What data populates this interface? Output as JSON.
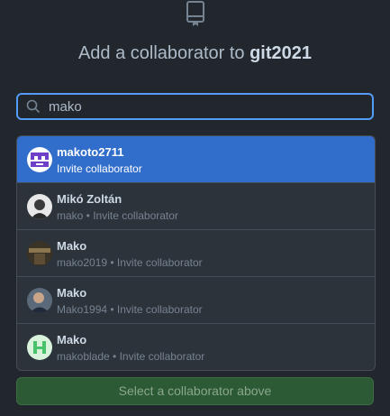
{
  "dialog": {
    "title_prefix": "Add a collaborator to",
    "repo_name": "git2021"
  },
  "search": {
    "value": "mako",
    "icon": "search-icon"
  },
  "results": [
    {
      "name": "makoto2711",
      "sub": "Invite collaborator",
      "selected": true,
      "avatar_color": "#6e40c9"
    },
    {
      "name": "Mikó Zoltán",
      "sub": "mako • Invite collaborator",
      "selected": false,
      "avatar_color": "#dcdcdc"
    },
    {
      "name": "Mako",
      "sub": "mako2019 • Invite collaborator",
      "selected": false,
      "avatar_color": "#6b5a3c"
    },
    {
      "name": "Mako",
      "sub": "Mako1994 • Invite collaborator",
      "selected": false,
      "avatar_color": "#4a4a4a"
    },
    {
      "name": "Mako",
      "sub": "makoblade • Invite collaborator",
      "selected": false,
      "avatar_color": "#4ac26b"
    }
  ],
  "button": {
    "label": "Select a collaborator above"
  },
  "colors": {
    "accent": "#539bf5",
    "selected_row": "#316dca",
    "button_bg": "#2c5a35"
  }
}
